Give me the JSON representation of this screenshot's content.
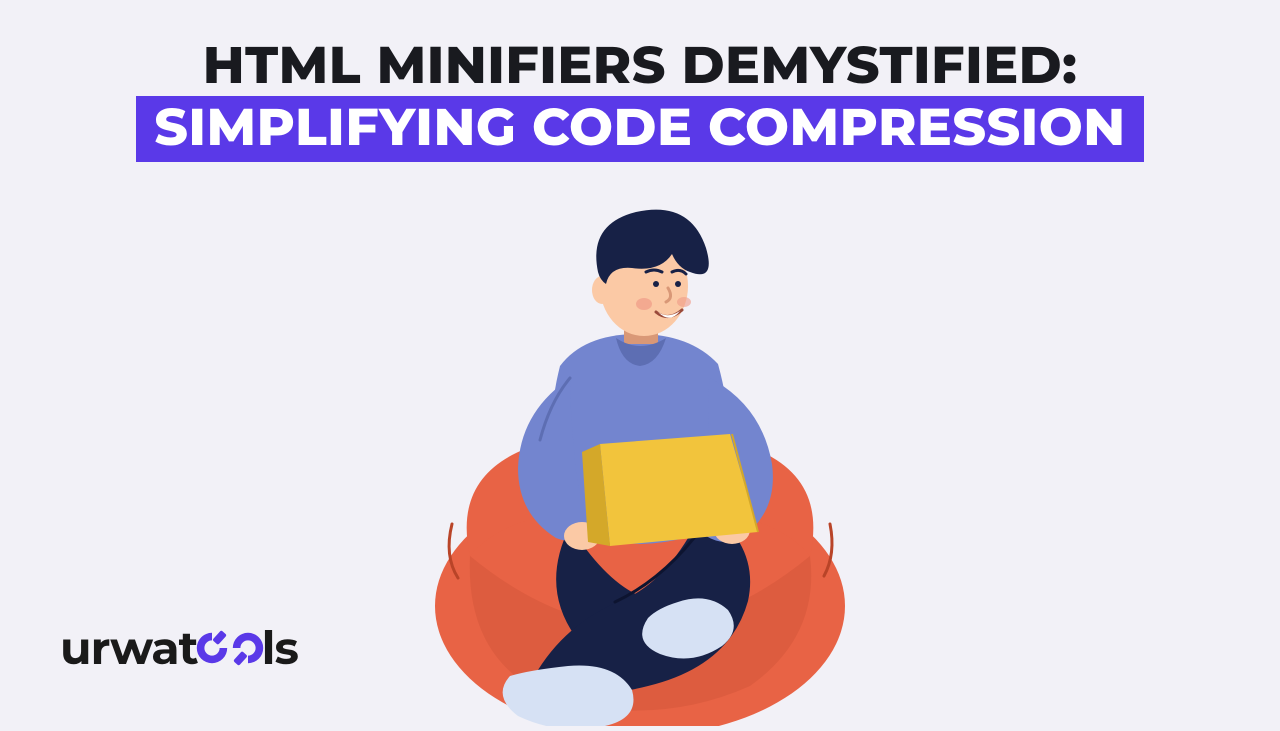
{
  "headline": {
    "line1": "HTML MINIFIERS DEMYSTIFIED:",
    "line2": "SIMPLIFYING CODE COMPRESSION"
  },
  "logo": {
    "prefix": "urwat",
    "suffix": "ls"
  },
  "palette": {
    "bg": "#f2f1f7",
    "accent": "#5a39e8",
    "text": "#191a1f",
    "beanbag": "#e86345",
    "beanbag_dark": "#c94f33",
    "shirt": "#7385cf",
    "shirt_dark": "#5d6eb3",
    "pants": "#172146",
    "skin": "#fbc9a5",
    "skin_dark": "#d99877",
    "hair": "#172146",
    "socks": "#d6e1f4",
    "laptop": "#f2c43c",
    "laptop_dark": "#d4a829"
  }
}
